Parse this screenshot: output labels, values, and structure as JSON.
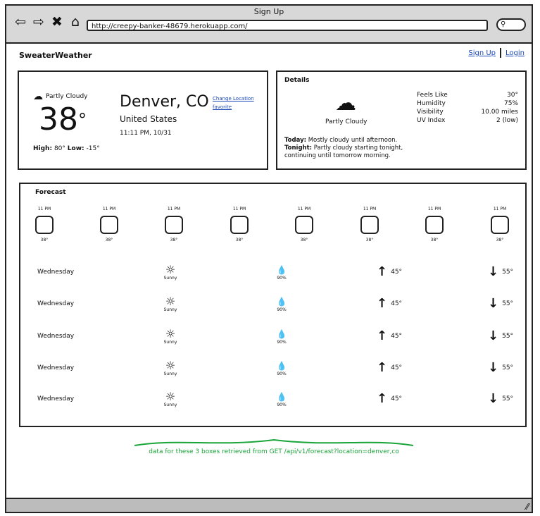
{
  "window": {
    "title": "Sign Up",
    "url": "http://creepy-banker-48679.herokuapp.com/"
  },
  "nav": {
    "back_icon": "back-arrow-icon",
    "forward_icon": "forward-arrow-icon",
    "close_icon": "close-icon",
    "home_icon": "home-icon",
    "search_icon": "search-icon"
  },
  "header": {
    "brand": "SweaterWeather",
    "signup": "Sign Up",
    "login": "Login"
  },
  "current": {
    "condition": "Partly Cloudy",
    "temp": "38",
    "degree": "°",
    "city": "Denver, CO",
    "country": "United States",
    "time": "11:11 PM, 10/31",
    "high_label": "High:",
    "high": "80°",
    "low_label": "Low:",
    "low": "-15°",
    "change_location": "Change Location",
    "favorite": "favorite"
  },
  "details": {
    "title": "Details",
    "condition": "Partly Cloudy",
    "rows": [
      {
        "label": "Feels Like",
        "value": "30°"
      },
      {
        "label": "Humidity",
        "value": "75%"
      },
      {
        "label": "Visibility",
        "value": "10.00 miles"
      },
      {
        "label": "UV Index",
        "value": "2 (low)"
      }
    ],
    "today_label": "Today:",
    "today": "Mostly cloudy until afternoon.",
    "tonight_label": "Tonight:",
    "tonight": "Partly cloudy starting tonight, continuing until tomorrow morning."
  },
  "forecast": {
    "title": "Forecast",
    "hours": [
      {
        "time": "11 PM",
        "temp": "38°"
      },
      {
        "time": "11 PM",
        "temp": "38°"
      },
      {
        "time": "11 PM",
        "temp": "38°"
      },
      {
        "time": "11 PM",
        "temp": "38°"
      },
      {
        "time": "11 PM",
        "temp": "38°"
      },
      {
        "time": "11 PM",
        "temp": "38°"
      },
      {
        "time": "11 PM",
        "temp": "38°"
      },
      {
        "time": "11 PM",
        "temp": "38°"
      }
    ],
    "days": [
      {
        "day": "Wednesday",
        "summary": "Sunny",
        "precip": "90%",
        "high": "45°",
        "low": "55°"
      },
      {
        "day": "Wednesday",
        "summary": "Sunny",
        "precip": "90%",
        "high": "45°",
        "low": "55°"
      },
      {
        "day": "Wednesday",
        "summary": "Sunny",
        "precip": "90%",
        "high": "45°",
        "low": "55°"
      },
      {
        "day": "Wednesday",
        "summary": "Sunny",
        "precip": "90%",
        "high": "45°",
        "low": "55°"
      },
      {
        "day": "Wednesday",
        "summary": "Sunny",
        "precip": "90%",
        "high": "45°",
        "low": "55°"
      }
    ]
  },
  "annotation": {
    "text": "data for these 3 boxes retrieved from GET /api/v1/forecast?location=denver,co",
    "color": "#1aa53a"
  }
}
